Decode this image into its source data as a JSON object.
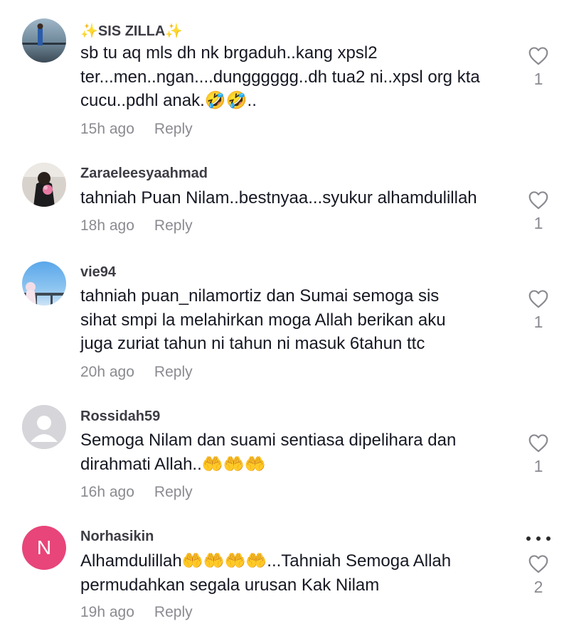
{
  "comments": [
    {
      "username": "✨SIS ZILLA✨",
      "lines": [
        "sb tu aq mls dh nk brgaduh..kang xpsl2",
        "ter...men..ngan....dungggggg..dh tua2 ni..xpsl org kta",
        "cucu..pdhl anak.🤣🤣.."
      ],
      "time": "15h ago",
      "reply_label": "Reply",
      "likes": "1"
    },
    {
      "username": "Zaraeleesyaahmad",
      "lines": [
        "tahniah Puan Nilam..bestnyaa...syukur alhamdulillah"
      ],
      "time": "18h ago",
      "reply_label": "Reply",
      "likes": "1"
    },
    {
      "username": "vie94",
      "lines": [
        "tahniah puan_nilamortiz dan Sumai semoga sis",
        "sihat smpi la melahirkan moga Allah berikan aku",
        "juga zuriat tahun ni tahun ni masuk 6tahun ttc"
      ],
      "time": "20h ago",
      "reply_label": "Reply",
      "likes": "1"
    },
    {
      "username": "Rossidah59",
      "lines": [
        "Semoga Nilam dan suami sentiasa dipelihara dan",
        "dirahmati Allah..🤲🤲🤲"
      ],
      "time": "16h ago",
      "reply_label": "Reply",
      "likes": "1"
    },
    {
      "username": "Norhasikin",
      "avatar_letter": "N",
      "lines": [
        "Alhamdulillah🤲🤲🤲🤲...Tahniah Semoga Allah",
        "permudahkan segala urusan Kak Nilam"
      ],
      "time": "19h ago",
      "reply_label": "Reply",
      "likes": "2"
    }
  ],
  "icons": {
    "like": "heart-outline-icon",
    "more": "more-dots-icon"
  },
  "colors": {
    "secondary_text": "#8a8b91",
    "letter_avatar_bg": "#e8457a"
  }
}
